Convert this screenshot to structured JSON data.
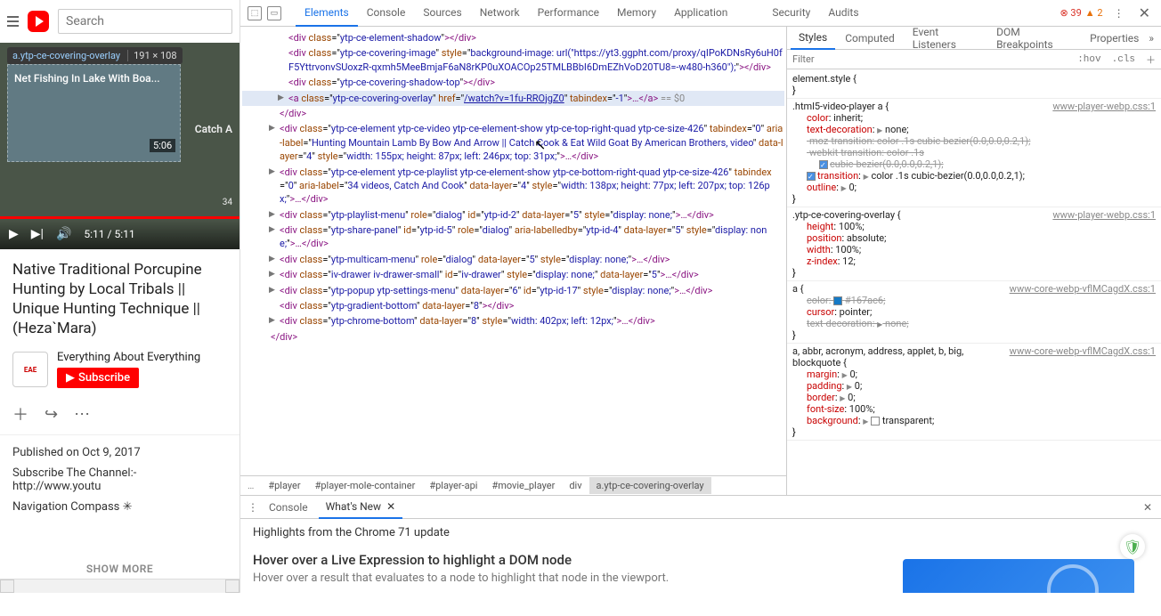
{
  "yt": {
    "search_placeholder": "Search",
    "tooltip_selector": "a.ytp-ce-covering-overlay",
    "tooltip_dims": "191 × 108",
    "thumb_title": "Net Fishing In Lake With Boa...",
    "thumb_duration": "5:06",
    "side_label": "Catch A",
    "side_count": "34",
    "time_display": "5:11 / 5:11",
    "video_title": "Native Traditional Porcupine Hunting by Local Tribals || Unique Hunting Technique || (Heza`Mara)",
    "channel_name": "Everything About Everything",
    "channel_abbrev": "EAE",
    "subscribe_label": "Subscribe",
    "publish_line": "Published on Oct 9, 2017",
    "desc_line": "Subscribe The Channel:- http://www.youtu",
    "nav_compass": "Navigation Compass ✳",
    "show_more": "SHOW MORE"
  },
  "devtools": {
    "tabs": [
      "Elements",
      "Console",
      "Sources",
      "Network",
      "Performance",
      "Memory",
      "Application",
      "Security",
      "Audits"
    ],
    "active_tab": "Elements",
    "error_count": "39",
    "warn_count": "2",
    "styles_tabs": [
      "Styles",
      "Computed",
      "Event Listeners",
      "DOM Breakpoints",
      "Properties"
    ],
    "filter_placeholder": "Filter",
    "hov_btn": ":hov",
    "cls_btn": ".cls",
    "element_style_label": "element.style {",
    "rule1_sel": ".html5-video-player a {",
    "rule1_link": "www-player-webp.css:1",
    "rule1_decls": [
      {
        "p": "color",
        "v": "inherit;",
        "struck": false
      },
      {
        "p": "text-decoration",
        "v": "none;",
        "tri": true,
        "struck": false
      },
      {
        "p": "-moz-transition",
        "v": "color .1s cubic-bezier(0.0,0.0,0.2,1);",
        "struck": true
      },
      {
        "p": "-webkit-transition",
        "v": "color .1s",
        "struck": true,
        "cont": true
      },
      {
        "p": "",
        "v": "cubic-bezier(0.0,0.0,0.2,1);",
        "struck": true,
        "chk": true,
        "indent": true
      },
      {
        "p": "transition",
        "v": "color .1s cubic-bezier(0.0,0.0,0.2,1);",
        "tri": true,
        "chk": true
      },
      {
        "p": "outline",
        "v": "0;",
        "tri": true
      }
    ],
    "rule2_sel": ".ytp-ce-covering-overlay {",
    "rule2_link": "www-player-webp.css:1",
    "rule2_decls": [
      {
        "p": "height",
        "v": "100%;"
      },
      {
        "p": "position",
        "v": "absolute;"
      },
      {
        "p": "width",
        "v": "100%;"
      },
      {
        "p": "z-index",
        "v": "12;"
      }
    ],
    "rule3_sel": "a {",
    "rule3_link": "www-core-webp-vflMCagdX.css:1",
    "rule3_decls": [
      {
        "p": "color",
        "v": "#167ac6;",
        "struck": true,
        "swatch": "#167ac6"
      },
      {
        "p": "cursor",
        "v": "pointer;"
      },
      {
        "p": "text-decoration",
        "v": "none;",
        "tri": true,
        "struck": true
      }
    ],
    "rule4_sel": "a, abbr, acronym, address, applet, b, big, blockquote {",
    "rule4_link": "www-core-webp-vflMCagdX.css:1",
    "rule4_decls": [
      {
        "p": "margin",
        "v": "0;",
        "tri": true
      },
      {
        "p": "padding",
        "v": "0;",
        "tri": true
      },
      {
        "p": "border",
        "v": "0;",
        "tri": true
      },
      {
        "p": "font-size",
        "v": "100%;"
      },
      {
        "p": "background",
        "v": "transparent;",
        "tri": true,
        "swatch": "transparent"
      }
    ],
    "breadcrumbs": [
      "…",
      "#player",
      "#player-mole-container",
      "#player-api",
      "#movie_player",
      "div",
      "a.ytp-ce-covering-overlay"
    ],
    "drawer_tabs": [
      "Console",
      "What's New"
    ],
    "highlights_title": "Highlights from the Chrome 71 update",
    "hover_title": "Hover over a Live Expression to highlight a DOM node",
    "hover_sub": "Hover over a result that evaluates to a node to highlight that node in the viewport."
  },
  "dom_lines": [
    {
      "ind": 40,
      "tog": "",
      "html": "<span class='tag'>&lt;div</span> <span class='attr-n'>class</span>=\"<span class='attr-v'>ytp-ce-element-shadow</span>\"<span class='tag'>&gt;&lt;/div&gt;</span>"
    },
    {
      "ind": 40,
      "tog": "",
      "html": "<span class='tag'>&lt;div</span> <span class='attr-n'>class</span>=\"<span class='attr-v'>ytp-ce-covering-image</span>\" <span class='attr-n'>style</span>=\"<span class='attr-v'>background-image: url(\"https://yt3.ggpht.com/proxy/qIPoKDNsRy6uH0fF5YttrvonvSUoxzR-qxmh5MeeBmjaF6aN8rKP0uXOACOp25TMLBBbI6DmEZhVoD20TU8=-w480-h360\");</span>\"<span class='tag'>&gt;&lt;/div&gt;</span>"
    },
    {
      "ind": 40,
      "tog": "",
      "html": "<span class='tag'>&lt;div</span> <span class='attr-n'>class</span>=\"<span class='attr-v'>ytp-ce-covering-shadow-top</span>\"<span class='tag'>&gt;&lt;/div&gt;</span>"
    },
    {
      "ind": 40,
      "tog": "▶",
      "sel": true,
      "html": "<span class='tag'>&lt;a</span> <span class='attr-n'>class</span>=\"<span class='attr-v'>ytp-ce-covering-overlay</span>\" <span class='attr-n'>href</span>=\"<span class='attr-link'>/watch?v=1fu-RROjgZ0</span>\" <span class='attr-n'>tabindex</span>=\"<span class='attr-v'>-1</span>\"<span class='tag'>&gt;…&lt;/a&gt;</span> <span class='eqvar'>== $0</span>"
    },
    {
      "ind": 30,
      "tog": "",
      "html": "<span class='tag'>&lt;/div&gt;</span>"
    },
    {
      "ind": 30,
      "tog": "▶",
      "html": "<span class='tag'>&lt;div</span> <span class='attr-n'>class</span>=\"<span class='attr-v'>ytp-ce-element ytp-ce-video ytp-ce-element-show ytp-ce-top-right-quad ytp-ce-size-426</span>\" <span class='attr-n'>tabindex</span>=\"<span class='attr-v'>0</span>\" <span class='attr-n'>aria-label</span>=\"<span class='attr-v'>Hunting Mountain Lamb By Bow And Arrow || Catch Cook & Eat Wild Goat By American Brothers, video</span>\" <span class='attr-n'>data-layer</span>=\"<span class='attr-v'>4</span>\" <span class='attr-n'>style</span>=\"<span class='attr-v'>width: 155px; height: 87px; left: 246px; top: 31px;</span>\"<span class='tag'>&gt;…&lt;/div&gt;</span>"
    },
    {
      "ind": 30,
      "tog": "▶",
      "html": "<span class='tag'>&lt;div</span> <span class='attr-n'>class</span>=\"<span class='attr-v'>ytp-ce-element ytp-ce-playlist ytp-ce-element-show ytp-ce-bottom-right-quad ytp-ce-size-426</span>\" <span class='attr-n'>tabindex</span>=\"<span class='attr-v'>0</span>\" <span class='attr-n'>aria-label</span>=\"<span class='attr-v'>34 videos, Catch And Cook</span>\" <span class='attr-n'>data-layer</span>=\"<span class='attr-v'>4</span>\" <span class='attr-n'>style</span>=\"<span class='attr-v'>width: 138px; height: 77px; left: 207px; top: 126px;</span>\"<span class='tag'>&gt;…&lt;/div&gt;</span>"
    },
    {
      "ind": 30,
      "tog": "▶",
      "html": "<span class='tag'>&lt;div</span> <span class='attr-n'>class</span>=\"<span class='attr-v'>ytp-playlist-menu</span>\" <span class='attr-n'>role</span>=\"<span class='attr-v'>dialog</span>\" <span class='attr-n'>id</span>=\"<span class='attr-v'>ytp-id-2</span>\" <span class='attr-n'>data-layer</span>=\"<span class='attr-v'>5</span>\" <span class='attr-n'>style</span>=\"<span class='attr-v'>display: none;</span>\"<span class='tag'>&gt;…&lt;/div&gt;</span>"
    },
    {
      "ind": 30,
      "tog": "▶",
      "html": "<span class='tag'>&lt;div</span> <span class='attr-n'>class</span>=\"<span class='attr-v'>ytp-share-panel</span>\" <span class='attr-n'>id</span>=\"<span class='attr-v'>ytp-id-5</span>\" <span class='attr-n'>role</span>=\"<span class='attr-v'>dialog</span>\" <span class='attr-n'>aria-labelledby</span>=\"<span class='attr-v'>ytp-id-4</span>\" <span class='attr-n'>data-layer</span>=\"<span class='attr-v'>5</span>\" <span class='attr-n'>style</span>=\"<span class='attr-v'>display: none;</span>\"<span class='tag'>&gt;…&lt;/div&gt;</span>"
    },
    {
      "ind": 30,
      "tog": "▶",
      "html": "<span class='tag'>&lt;div</span> <span class='attr-n'>class</span>=\"<span class='attr-v'>ytp-multicam-menu</span>\" <span class='attr-n'>role</span>=\"<span class='attr-v'>dialog</span>\" <span class='attr-n'>data-layer</span>=\"<span class='attr-v'>5</span>\" <span class='attr-n'>style</span>=\"<span class='attr-v'>display: none;</span>\"<span class='tag'>&gt;…&lt;/div&gt;</span>"
    },
    {
      "ind": 30,
      "tog": "▶",
      "html": "<span class='tag'>&lt;div</span> <span class='attr-n'>class</span>=\"<span class='attr-v'>iv-drawer iv-drawer-small</span>\" <span class='attr-n'>id</span>=\"<span class='attr-v'>iv-drawer</span>\" <span class='attr-n'>style</span>=\"<span class='attr-v'>display: none;</span>\" <span class='attr-n'>data-layer</span>=\"<span class='attr-v'>5</span>\"<span class='tag'>&gt;…&lt;/div&gt;</span>"
    },
    {
      "ind": 30,
      "tog": "▶",
      "html": "<span class='tag'>&lt;div</span> <span class='attr-n'>class</span>=\"<span class='attr-v'>ytp-popup ytp-settings-menu</span>\" <span class='attr-n'>data-layer</span>=\"<span class='attr-v'>6</span>\" <span class='attr-n'>id</span>=\"<span class='attr-v'>ytp-id-17</span>\" <span class='attr-n'>style</span>=\"<span class='attr-v'>display: none;</span>\"<span class='tag'>&gt;…&lt;/div&gt;</span>"
    },
    {
      "ind": 30,
      "tog": "",
      "html": "<span class='tag'>&lt;div</span> <span class='attr-n'>class</span>=\"<span class='attr-v'>ytp-gradient-bottom</span>\" <span class='attr-n'>data-layer</span>=\"<span class='attr-v'>8</span>\"<span class='tag'>&gt;&lt;/div&gt;</span>"
    },
    {
      "ind": 30,
      "tog": "▶",
      "html": "<span class='tag'>&lt;div</span> <span class='attr-n'>class</span>=\"<span class='attr-v'>ytp-chrome-bottom</span>\" <span class='attr-n'>data-layer</span>=\"<span class='attr-v'>8</span>\" <span class='attr-n'>style</span>=\"<span class='attr-v'>width: 402px; left: 12px;</span>\"<span class='tag'>&gt;…&lt;/div&gt;</span>"
    },
    {
      "ind": 20,
      "tog": "",
      "html": "<span class='tag'>&lt;/div&gt;</span>"
    }
  ]
}
